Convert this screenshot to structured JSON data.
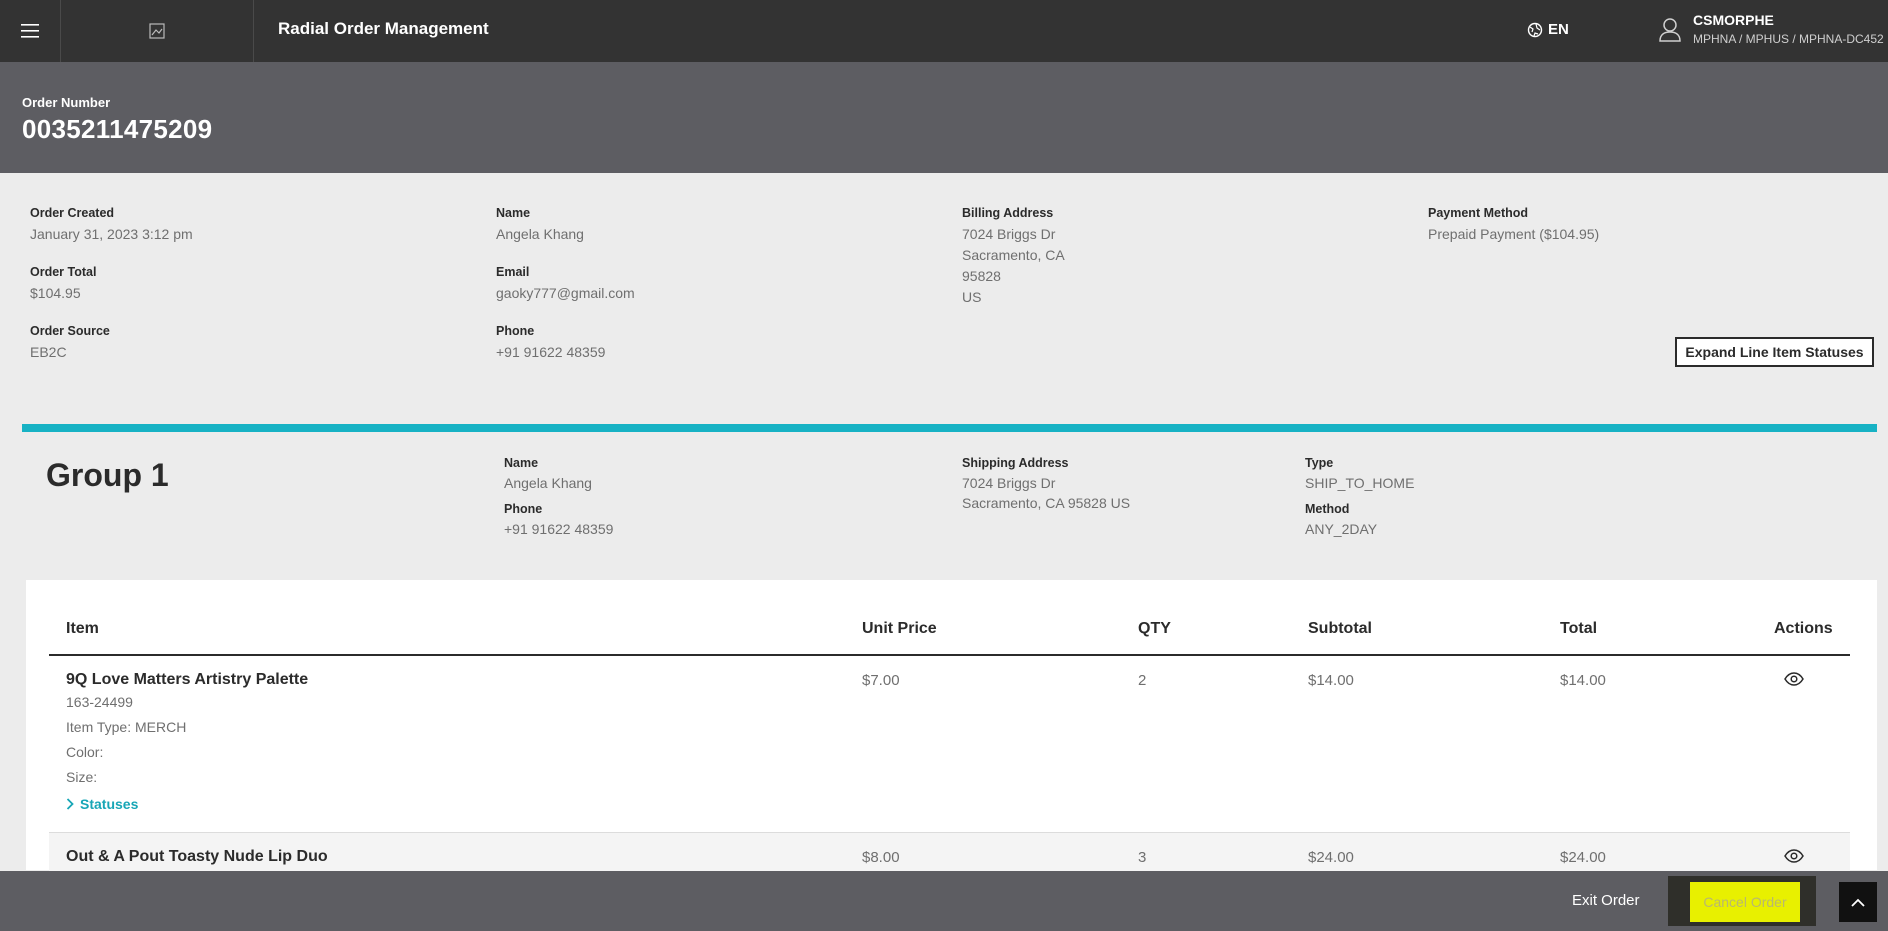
{
  "topbar": {
    "app_title": "Radial Order Management",
    "language": "EN",
    "user_name": "CSMORPHE",
    "user_org": "MPHNA / MPHUS / MPHNA-DC452"
  },
  "order": {
    "number_label": "Order Number",
    "number": "0035211475209"
  },
  "summary": {
    "created_label": "Order Created",
    "created": "January 31, 2023 3:12 pm",
    "total_label": "Order Total",
    "total": "$104.95",
    "source_label": "Order Source",
    "source": "EB2C",
    "name_label": "Name",
    "name": "Angela Khang",
    "email_label": "Email",
    "email": "gaoky777@gmail.com",
    "phone_label": "Phone",
    "phone": "+91 91622 48359",
    "billing_label": "Billing Address",
    "billing_line1": "7024 Briggs Dr",
    "billing_line2": "Sacramento, CA",
    "billing_line3": "95828",
    "billing_line4": "US",
    "payment_label": "Payment Method",
    "payment": "Prepaid Payment ($104.95)",
    "expand_button": "Expand Line Item Statuses"
  },
  "group": {
    "title": "Group 1",
    "name_label": "Name",
    "name": "Angela Khang",
    "phone_label": "Phone",
    "phone": "+91 91622 48359",
    "shipping_label": "Shipping Address",
    "shipping_line1": "7024 Briggs Dr",
    "shipping_line2": "Sacramento, CA 95828 US",
    "type_label": "Type",
    "type": "SHIP_TO_HOME",
    "method_label": "Method",
    "method": "ANY_2DAY"
  },
  "table": {
    "headers": {
      "item": "Item",
      "unit_price": "Unit Price",
      "qty": "QTY",
      "subtotal": "Subtotal",
      "total": "Total",
      "actions": "Actions"
    },
    "rows": [
      {
        "name": "9Q Love Matters Artistry Palette",
        "sku": "163-24499",
        "item_type": "Item Type: MERCH",
        "color": "Color:",
        "size": "Size:",
        "statuses": "Statuses",
        "unit_price": "$7.00",
        "qty": "2",
        "subtotal": "$14.00",
        "total": "$14.00"
      },
      {
        "name": "Out & A Pout Toasty Nude Lip Duo",
        "unit_price": "$8.00",
        "qty": "3",
        "subtotal": "$24.00",
        "total": "$24.00"
      }
    ]
  },
  "bottombar": {
    "exit_label": "Exit Order",
    "cancel_label": "Cancel Order"
  },
  "icons": {
    "menu": "hamburger-icon",
    "language": "globe-icon",
    "user": "user-icon",
    "view": "eye-icon",
    "expand": "chevron-right-icon",
    "scroll_top": "chevron-up-icon"
  },
  "colors": {
    "accent": "#17b2c4",
    "topbar": "#333333",
    "header": "#5d5d62",
    "cancel_highlight": "#e8f000"
  }
}
